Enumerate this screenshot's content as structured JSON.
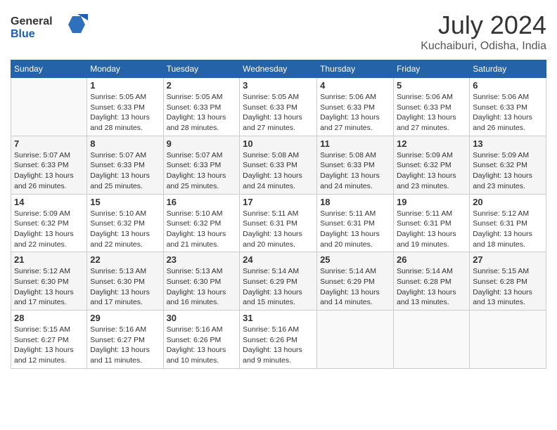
{
  "header": {
    "logo_line1": "General",
    "logo_line2": "Blue",
    "month_year": "July 2024",
    "location": "Kuchaiburi, Odisha, India"
  },
  "days_of_week": [
    "Sunday",
    "Monday",
    "Tuesday",
    "Wednesday",
    "Thursday",
    "Friday",
    "Saturday"
  ],
  "weeks": [
    [
      {
        "day": "",
        "info": ""
      },
      {
        "day": "1",
        "info": "Sunrise: 5:05 AM\nSunset: 6:33 PM\nDaylight: 13 hours\nand 28 minutes."
      },
      {
        "day": "2",
        "info": "Sunrise: 5:05 AM\nSunset: 6:33 PM\nDaylight: 13 hours\nand 28 minutes."
      },
      {
        "day": "3",
        "info": "Sunrise: 5:05 AM\nSunset: 6:33 PM\nDaylight: 13 hours\nand 27 minutes."
      },
      {
        "day": "4",
        "info": "Sunrise: 5:06 AM\nSunset: 6:33 PM\nDaylight: 13 hours\nand 27 minutes."
      },
      {
        "day": "5",
        "info": "Sunrise: 5:06 AM\nSunset: 6:33 PM\nDaylight: 13 hours\nand 27 minutes."
      },
      {
        "day": "6",
        "info": "Sunrise: 5:06 AM\nSunset: 6:33 PM\nDaylight: 13 hours\nand 26 minutes."
      }
    ],
    [
      {
        "day": "7",
        "info": "Sunrise: 5:07 AM\nSunset: 6:33 PM\nDaylight: 13 hours\nand 26 minutes."
      },
      {
        "day": "8",
        "info": "Sunrise: 5:07 AM\nSunset: 6:33 PM\nDaylight: 13 hours\nand 25 minutes."
      },
      {
        "day": "9",
        "info": "Sunrise: 5:07 AM\nSunset: 6:33 PM\nDaylight: 13 hours\nand 25 minutes."
      },
      {
        "day": "10",
        "info": "Sunrise: 5:08 AM\nSunset: 6:33 PM\nDaylight: 13 hours\nand 24 minutes."
      },
      {
        "day": "11",
        "info": "Sunrise: 5:08 AM\nSunset: 6:33 PM\nDaylight: 13 hours\nand 24 minutes."
      },
      {
        "day": "12",
        "info": "Sunrise: 5:09 AM\nSunset: 6:32 PM\nDaylight: 13 hours\nand 23 minutes."
      },
      {
        "day": "13",
        "info": "Sunrise: 5:09 AM\nSunset: 6:32 PM\nDaylight: 13 hours\nand 23 minutes."
      }
    ],
    [
      {
        "day": "14",
        "info": "Sunrise: 5:09 AM\nSunset: 6:32 PM\nDaylight: 13 hours\nand 22 minutes."
      },
      {
        "day": "15",
        "info": "Sunrise: 5:10 AM\nSunset: 6:32 PM\nDaylight: 13 hours\nand 22 minutes."
      },
      {
        "day": "16",
        "info": "Sunrise: 5:10 AM\nSunset: 6:32 PM\nDaylight: 13 hours\nand 21 minutes."
      },
      {
        "day": "17",
        "info": "Sunrise: 5:11 AM\nSunset: 6:31 PM\nDaylight: 13 hours\nand 20 minutes."
      },
      {
        "day": "18",
        "info": "Sunrise: 5:11 AM\nSunset: 6:31 PM\nDaylight: 13 hours\nand 20 minutes."
      },
      {
        "day": "19",
        "info": "Sunrise: 5:11 AM\nSunset: 6:31 PM\nDaylight: 13 hours\nand 19 minutes."
      },
      {
        "day": "20",
        "info": "Sunrise: 5:12 AM\nSunset: 6:31 PM\nDaylight: 13 hours\nand 18 minutes."
      }
    ],
    [
      {
        "day": "21",
        "info": "Sunrise: 5:12 AM\nSunset: 6:30 PM\nDaylight: 13 hours\nand 17 minutes."
      },
      {
        "day": "22",
        "info": "Sunrise: 5:13 AM\nSunset: 6:30 PM\nDaylight: 13 hours\nand 17 minutes."
      },
      {
        "day": "23",
        "info": "Sunrise: 5:13 AM\nSunset: 6:30 PM\nDaylight: 13 hours\nand 16 minutes."
      },
      {
        "day": "24",
        "info": "Sunrise: 5:14 AM\nSunset: 6:29 PM\nDaylight: 13 hours\nand 15 minutes."
      },
      {
        "day": "25",
        "info": "Sunrise: 5:14 AM\nSunset: 6:29 PM\nDaylight: 13 hours\nand 14 minutes."
      },
      {
        "day": "26",
        "info": "Sunrise: 5:14 AM\nSunset: 6:28 PM\nDaylight: 13 hours\nand 13 minutes."
      },
      {
        "day": "27",
        "info": "Sunrise: 5:15 AM\nSunset: 6:28 PM\nDaylight: 13 hours\nand 13 minutes."
      }
    ],
    [
      {
        "day": "28",
        "info": "Sunrise: 5:15 AM\nSunset: 6:27 PM\nDaylight: 13 hours\nand 12 minutes."
      },
      {
        "day": "29",
        "info": "Sunrise: 5:16 AM\nSunset: 6:27 PM\nDaylight: 13 hours\nand 11 minutes."
      },
      {
        "day": "30",
        "info": "Sunrise: 5:16 AM\nSunset: 6:26 PM\nDaylight: 13 hours\nand 10 minutes."
      },
      {
        "day": "31",
        "info": "Sunrise: 5:16 AM\nSunset: 6:26 PM\nDaylight: 13 hours\nand 9 minutes."
      },
      {
        "day": "",
        "info": ""
      },
      {
        "day": "",
        "info": ""
      },
      {
        "day": "",
        "info": ""
      }
    ]
  ]
}
